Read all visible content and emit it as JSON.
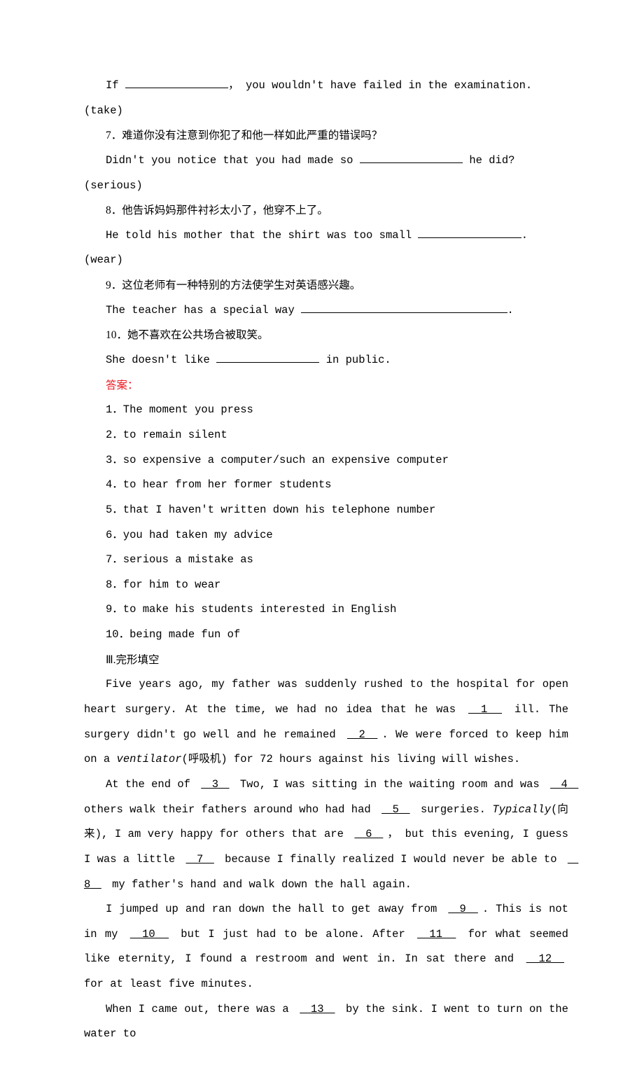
{
  "q6b": "If ",
  "q6c": "， you wouldn't have failed in the examination.(take)",
  "q7a": "7．难道你没有注意到你犯了和他一样如此严重的错误吗？",
  "q7b": "Didn't you notice that you had made so ",
  "q7c": " he did? (serious)",
  "q8a": "8．他告诉妈妈那件衬衫太小了，他穿不上了。",
  "q8b": "He told his mother that the shirt was too small ",
  "q8c": ". (wear)",
  "q9a": "9．这位老师有一种特别的方法使学生对英语感兴趣。",
  "q9b": "The teacher has a special way ",
  "q9c": ".",
  "q10a": "10．她不喜欢在公共场合被取笑。",
  "q10b": "She doesn't like ",
  "q10c": " in public.",
  "ansTitle": "答案：",
  "a1": "1．The moment you press",
  "a2": "2．to remain silent",
  "a3": "3．so expensive a computer/such an expensive computer",
  "a4": "4．to hear from her former students",
  "a5": "5．that I haven't written down his telephone number",
  "a6": "6．you had taken my advice",
  "a7": "7．serious a mistake as",
  "a8": "8．for him to wear",
  "a9": "9．to make his students interested in English",
  "a10": "10．being made fun of",
  "section3": "Ⅲ.完形填空",
  "p1a": "Five years ago, my father was suddenly rushed to the hospital for open heart surgery. At the time, we had no idea that he was ",
  "b1": "　1　",
  "p1b": " ill. The surgery didn't go well and he remained ",
  "b2": "　2　",
  "p1c": ". We were forced to keep him on a ",
  "ventilator": "ventilator",
  "ventilator_cn": "(呼吸机) for 72 hours against his living will wishes.",
  "p2a": "At the end of ",
  "b3": "　3　",
  "p2b": " Two, I was sitting in the waiting room and was ",
  "b4": "　4　",
  "p2c": " others walk their fathers around who had had ",
  "b5": "　5　",
  "p2d": " surgeries. ",
  "typically": "Typically",
  "typically_cn": "(向来), I am very happy for others that are ",
  "b6": "　6　",
  "p2e": "， but this evening, I guess I was a little ",
  "b7": "　7　",
  "p2f": " because I finally realized I would never be able to ",
  "b8": "　8　",
  "p2g": " my father's hand and walk down the hall again.",
  "p3a": "I jumped up and ran down the hall to get away from ",
  "b9": "　9　",
  "p3b": ". This is not in my ",
  "b10": "　10　",
  "p3c": " but I just had to be alone. After ",
  "b11": "　11　",
  "p3d": " for what seemed like eternity, I found a restroom and went in. In sat there and ",
  "b12": "　12　",
  "p3e": " for at least five minutes.",
  "p4a": "When I came out, there was a ",
  "b13": "　13　",
  "p4b": " by the sink. I went to turn on the water to"
}
